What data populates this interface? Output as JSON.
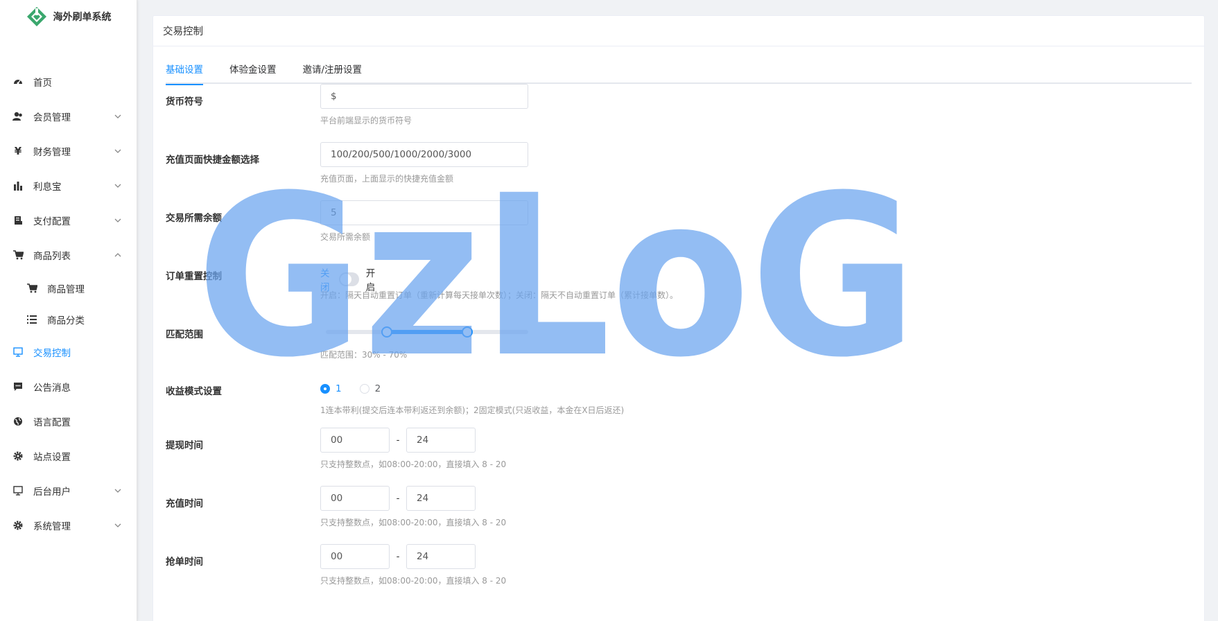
{
  "brand": {
    "title": "海外刷单系统",
    "color": "#3aa76d"
  },
  "sidebar": {
    "items": [
      {
        "label": "首页",
        "icon": "dashboard-icon",
        "chevron": ""
      },
      {
        "label": "会员管理",
        "icon": "users-icon",
        "chevron": "down"
      },
      {
        "label": "财务管理",
        "icon": "yen-icon",
        "chevron": "down"
      },
      {
        "label": "利息宝",
        "icon": "bar-chart-icon",
        "chevron": "down"
      },
      {
        "label": "支付配置",
        "icon": "receipt-icon",
        "chevron": "down"
      },
      {
        "label": "商品列表",
        "icon": "cart-icon",
        "chevron": "up"
      },
      {
        "label": "商品管理",
        "icon": "cart-icon",
        "chevron": ""
      },
      {
        "label": "商品分类",
        "icon": "list-icon",
        "chevron": ""
      },
      {
        "label": "交易控制",
        "icon": "monitor-icon",
        "chevron": ""
      },
      {
        "label": "公告消息",
        "icon": "message-icon",
        "chevron": ""
      },
      {
        "label": "语言配置",
        "icon": "globe-icon",
        "chevron": ""
      },
      {
        "label": "站点设置",
        "icon": "gear-icon",
        "chevron": ""
      },
      {
        "label": "后台用户",
        "icon": "monitor-icon",
        "chevron": "down"
      },
      {
        "label": "系统管理",
        "icon": "gear-icon",
        "chevron": "down"
      }
    ],
    "active": "交易控制",
    "accent": "#1890ff"
  },
  "card": {
    "title": "交易控制"
  },
  "tabs": [
    {
      "label": "基础设置"
    },
    {
      "label": "体验金设置"
    },
    {
      "label": "邀请/注册设置"
    }
  ],
  "form": {
    "currency": {
      "label": "货币符号",
      "value": "$",
      "help": "平台前端显示的货币符号"
    },
    "quick_amounts": {
      "label": "充值页面快捷金额选择",
      "value": "100/200/500/1000/2000/3000",
      "help": "充值页面，上面显示的快捷充值金额"
    },
    "min_balance": {
      "label": "交易所需余额",
      "value": "5",
      "help": "交易所需余额"
    },
    "order_reset": {
      "label": "订单重置控制",
      "off_label": "关闭",
      "on_label": "开启",
      "help": "开启：隔天自动重置订单（重新计算每天接单次数）；关闭：隔天不自动重置订单（累计接单数）。"
    },
    "match_range": {
      "label": "匹配范围",
      "min": 30,
      "max": 70,
      "help": "匹配范围：30% - 70%"
    },
    "profit_mode": {
      "label": "收益模式设置",
      "options": [
        "1",
        "2"
      ],
      "selected": "1",
      "help": "1连本带利(提交后连本带利返还到余额)；2固定模式(只返收益，本金在X日后返还)"
    },
    "withdraw_time": {
      "label": "提现时间",
      "from": "00",
      "to": "24",
      "sep": "-",
      "help": "只支持整数点，如08:00-20:00，直接填入 8 - 20"
    },
    "recharge_time": {
      "label": "充值时间",
      "from": "00",
      "to": "24",
      "sep": "-",
      "help": "只支持整数点，如08:00-20:00，直接填入 8 - 20"
    },
    "grab_time": {
      "label": "抢单时间",
      "from": "00",
      "to": "24",
      "sep": "-",
      "help": "只支持整数点，如08:00-20:00，直接填入 8 - 20"
    }
  },
  "watermark": {
    "text": "GzLoG",
    "color": "#6aa4ee"
  }
}
